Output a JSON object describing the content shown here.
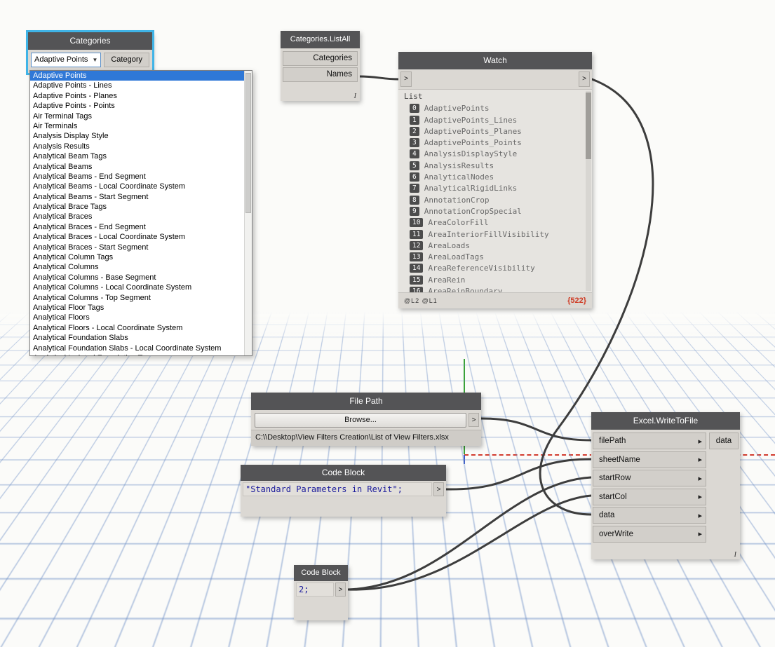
{
  "colors": {
    "node_header": "#545456",
    "node_body": "#dbd8d3",
    "selection_blue": "#40b4e7",
    "list_selection_blue": "#2f78d7",
    "code_text": "#1d1d9c",
    "count_red": "#cf3a23",
    "axis_x_red": "#d23b2e",
    "axis_y_green": "#3aa23a",
    "grid_blue": "#6c8ec6",
    "wire": "#3d3d3d"
  },
  "nodes": {
    "categories": {
      "title": "Categories",
      "dropdown_value": "Adaptive Points",
      "output": "Category",
      "selected_index": 0,
      "list_items": [
        "Adaptive Points",
        "Adaptive Points - Lines",
        "Adaptive Points - Planes",
        "Adaptive Points - Points",
        "Air Terminal Tags",
        "Air Terminals",
        "Analysis Display Style",
        "Analysis Results",
        "Analytical Beam Tags",
        "Analytical Beams",
        "Analytical Beams - End Segment",
        "Analytical Beams - Local Coordinate System",
        "Analytical Beams - Start Segment",
        "Analytical Brace Tags",
        "Analytical Braces",
        "Analytical Braces - End Segment",
        "Analytical Braces - Local Coordinate System",
        "Analytical Braces - Start Segment",
        "Analytical Column Tags",
        "Analytical Columns",
        "Analytical Columns - Base Segment",
        "Analytical Columns - Local Coordinate System",
        "Analytical Columns - Top Segment",
        "Analytical Floor Tags",
        "Analytical Floors",
        "Analytical Floors - Local Coordinate System",
        "Analytical Foundation Slabs",
        "Analytical Foundation Slabs - Local Coordinate System",
        "Analytical Isolated Foundation Tags"
      ]
    },
    "categories_listall": {
      "title": "Categories.ListAll",
      "outputs": [
        "Categories",
        "Names"
      ],
      "lacing": "I"
    },
    "watch": {
      "title": "Watch",
      "in_port": ">",
      "out_port": ">",
      "list_label": "List",
      "levels": "@L2 @L1",
      "count_badge": "{522}",
      "items": [
        {
          "index": "0",
          "value": "AdaptivePoints"
        },
        {
          "index": "1",
          "value": "AdaptivePoints_Lines"
        },
        {
          "index": "2",
          "value": "AdaptivePoints_Planes"
        },
        {
          "index": "3",
          "value": "AdaptivePoints_Points"
        },
        {
          "index": "4",
          "value": "AnalysisDisplayStyle"
        },
        {
          "index": "5",
          "value": "AnalysisResults"
        },
        {
          "index": "6",
          "value": "AnalyticalNodes"
        },
        {
          "index": "7",
          "value": "AnalyticalRigidLinks"
        },
        {
          "index": "8",
          "value": "AnnotationCrop"
        },
        {
          "index": "9",
          "value": "AnnotationCropSpecial"
        },
        {
          "index": "10",
          "value": "AreaColorFill"
        },
        {
          "index": "11",
          "value": "AreaInteriorFillVisibility"
        },
        {
          "index": "12",
          "value": "AreaLoads"
        },
        {
          "index": "13",
          "value": "AreaLoadTags"
        },
        {
          "index": "14",
          "value": "AreaReferenceVisibility"
        },
        {
          "index": "15",
          "value": "AreaRein"
        },
        {
          "index": "16",
          "value": "AreaReinBoundary"
        }
      ]
    },
    "file_path": {
      "title": "File Path",
      "browse_label": "Browse...",
      "path": "C:\\\\Desktop\\View Filters Creation\\List of View Filters.xlsx",
      "out_port": ">"
    },
    "code_block_text": {
      "title": "Code Block",
      "code": "\"Standard Parameters in Revit\";",
      "out_port": ">"
    },
    "code_block_number": {
      "title": "Code Block",
      "code": "2;",
      "out_port": ">"
    },
    "excel_write": {
      "title": "Excel.WriteToFile",
      "inputs": [
        "filePath",
        "sheetName",
        "startRow",
        "startCol",
        "data",
        "overWrite"
      ],
      "output": "data",
      "lacing": "I"
    }
  }
}
